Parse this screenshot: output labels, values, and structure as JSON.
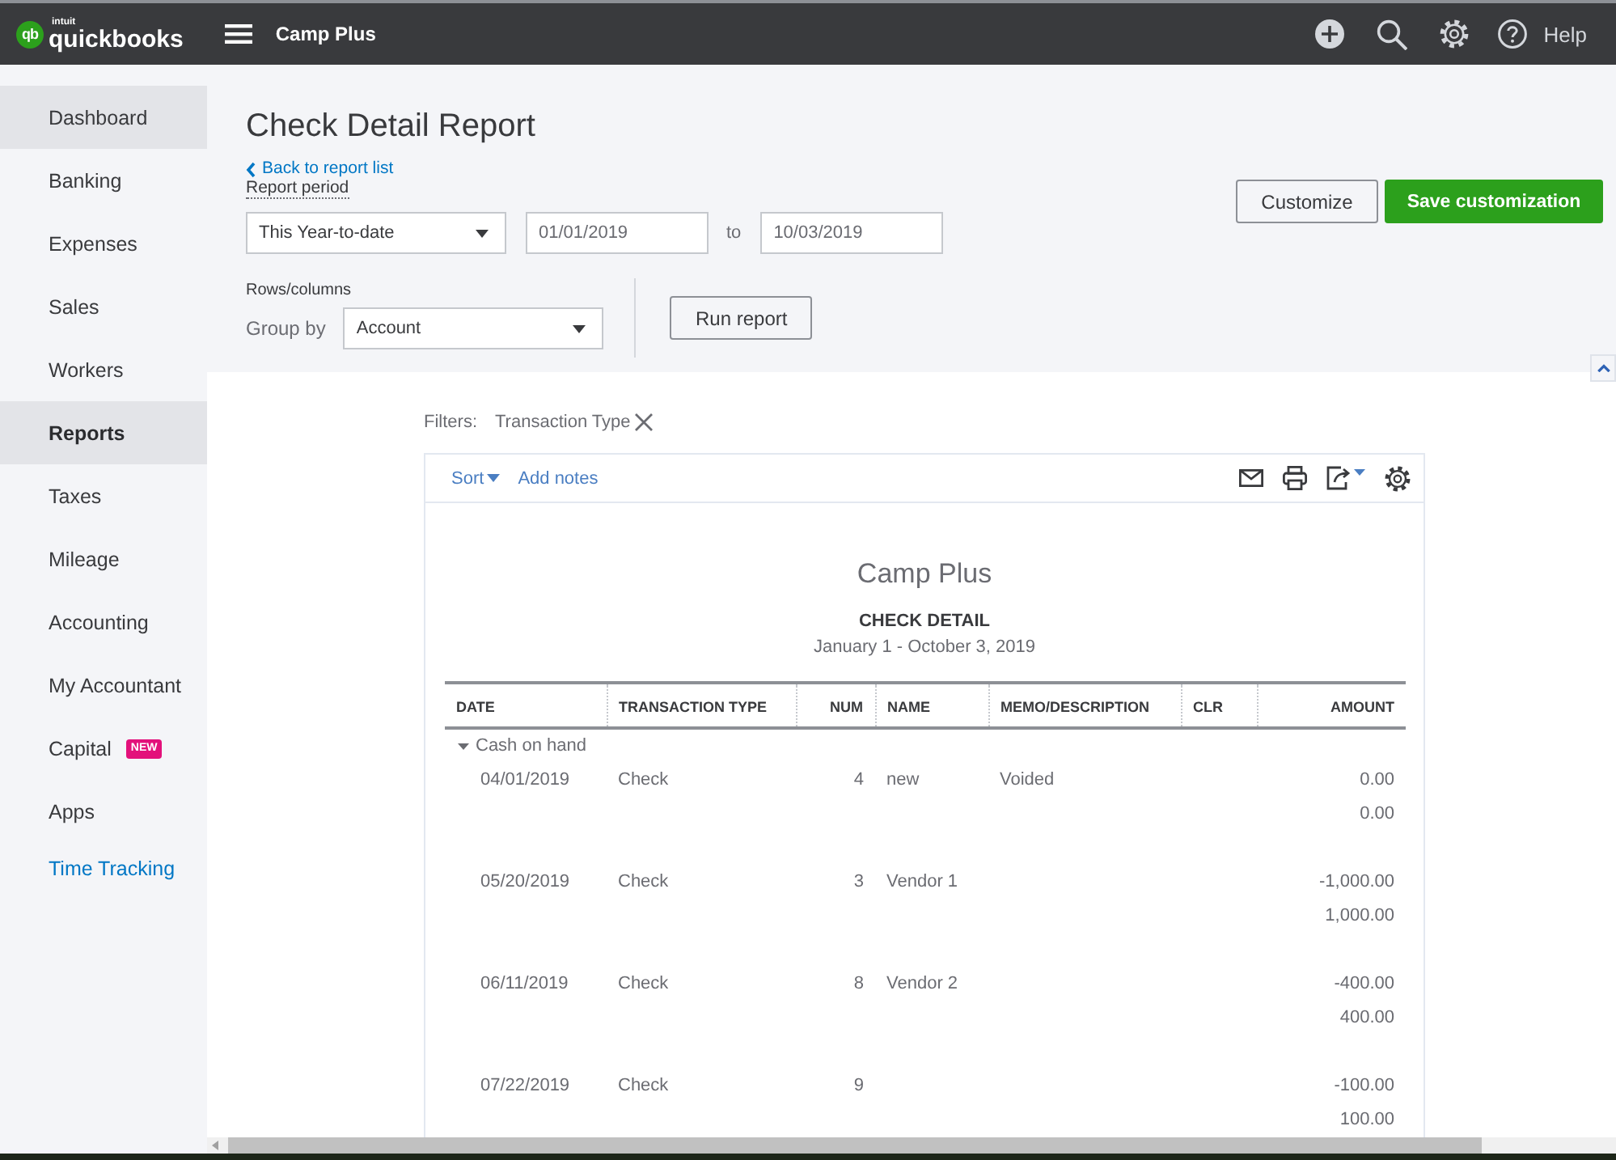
{
  "top_bar": {
    "logo": {
      "badge": "qb",
      "tagline": "intuit",
      "wordmark": "quickbooks"
    },
    "company": "Camp Plus",
    "help_label": "Help"
  },
  "sidebar": {
    "items": [
      {
        "label": "Dashboard",
        "kind": "nav",
        "selected": false,
        "hovered": true
      },
      {
        "label": "Banking",
        "kind": "nav",
        "selected": false,
        "hovered": false
      },
      {
        "label": "Expenses",
        "kind": "nav",
        "selected": false,
        "hovered": false
      },
      {
        "label": "Sales",
        "kind": "nav",
        "selected": false,
        "hovered": false
      },
      {
        "label": "Workers",
        "kind": "nav",
        "selected": false,
        "hovered": false
      },
      {
        "label": "Reports",
        "kind": "nav",
        "selected": true,
        "hovered": false
      },
      {
        "label": "Taxes",
        "kind": "nav",
        "selected": false,
        "hovered": false
      },
      {
        "label": "Mileage",
        "kind": "nav",
        "selected": false,
        "hovered": false
      },
      {
        "label": "Accounting",
        "kind": "nav",
        "selected": false,
        "hovered": false
      },
      {
        "label": "My Accountant",
        "kind": "nav",
        "selected": false,
        "hovered": false
      },
      {
        "label": "Capital",
        "kind": "nav",
        "selected": false,
        "hovered": false,
        "badge": "NEW"
      },
      {
        "label": "Apps",
        "kind": "nav",
        "selected": false,
        "hovered": false
      },
      {
        "label": "Time Tracking",
        "kind": "link",
        "selected": false,
        "hovered": false
      }
    ]
  },
  "header": {
    "title": "Check Detail Report",
    "back_link": "Back to report list",
    "report_period": {
      "label": "Report period",
      "preset": "This Year-to-date",
      "start": "01/01/2019",
      "separator": "to",
      "end": "10/03/2019"
    },
    "rows_columns": {
      "label": "Rows/columns",
      "group_by_label": "Group by",
      "group_by": "Account"
    },
    "run_button": "Run report",
    "actions": [
      {
        "label": "Customize",
        "kind": "secondary"
      },
      {
        "label": "Save customization",
        "kind": "primary"
      }
    ]
  },
  "filters": {
    "label": "Filters:",
    "chips": [
      {
        "label": "Transaction Type"
      }
    ]
  },
  "report": {
    "toolbar": {
      "sort": "Sort",
      "add_notes": "Add notes"
    },
    "company": "Camp Plus",
    "title": "CHECK DETAIL",
    "period": "January 1 - October 3, 2019",
    "table": {
      "columns": [
        {
          "label": "DATE",
          "kind": "text"
        },
        {
          "label": "TRANSACTION TYPE",
          "kind": "text"
        },
        {
          "label": "NUM",
          "kind": "number"
        },
        {
          "label": "NAME",
          "kind": "text"
        },
        {
          "label": "MEMO/DESCRIPTION",
          "kind": "text"
        },
        {
          "label": "CLR",
          "kind": "text"
        },
        {
          "label": "AMOUNT",
          "kind": "number"
        }
      ],
      "groups": [
        {
          "name": "Cash on hand",
          "expanded": true,
          "rows": [
            {
              "date": "04/01/2019",
              "transaction_type": "Check",
              "num": "4",
              "name": "new",
              "memo_description": "Voided",
              "amount": "0.00",
              "total": "0.00"
            },
            {
              "date": "05/20/2019",
              "transaction_type": "Check",
              "num": "3",
              "name": "Vendor 1",
              "amount": "-1,000.00",
              "total": "1,000.00"
            },
            {
              "date": "06/11/2019",
              "transaction_type": "Check",
              "num": "8",
              "name": "Vendor 2",
              "amount": "-400.00",
              "total": "400.00"
            },
            {
              "date": "07/22/2019",
              "transaction_type": "Check",
              "num": "9",
              "amount": "-100.00",
              "total": "100.00"
            }
          ]
        }
      ]
    }
  }
}
